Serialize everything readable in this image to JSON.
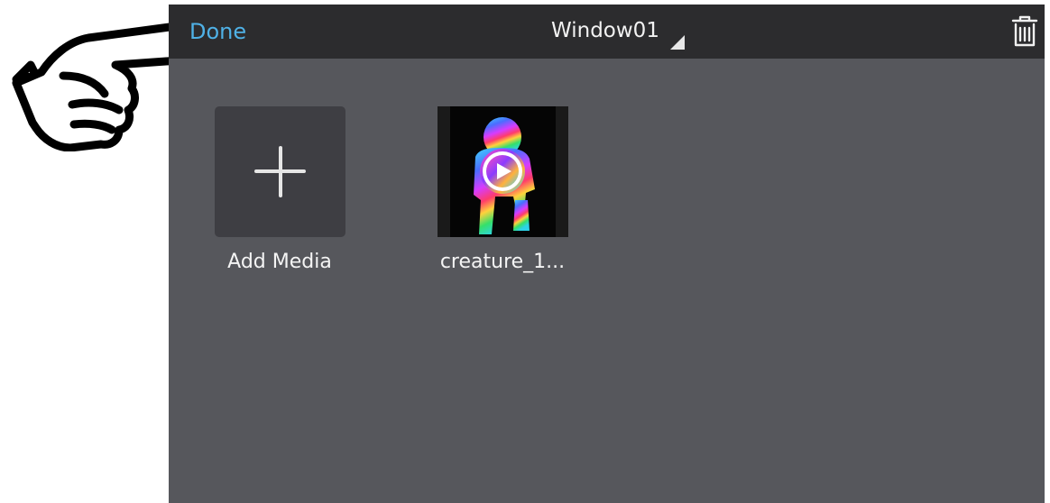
{
  "header": {
    "done_label": "Done",
    "title": "Window01",
    "done_color": "#4fb1e6",
    "background": "#2c2c2e"
  },
  "icons": {
    "title_menu": "dropdown-caret-icon",
    "delete": "trash-icon",
    "add": "plus-icon",
    "play": "play-icon",
    "annotation": "pointing-hand-icon"
  },
  "media": {
    "add_label": "Add Media",
    "items": [
      {
        "label": "creature_1..."
      }
    ]
  },
  "colors": {
    "workspace": "#56575c",
    "tile": "#3e3e43"
  }
}
